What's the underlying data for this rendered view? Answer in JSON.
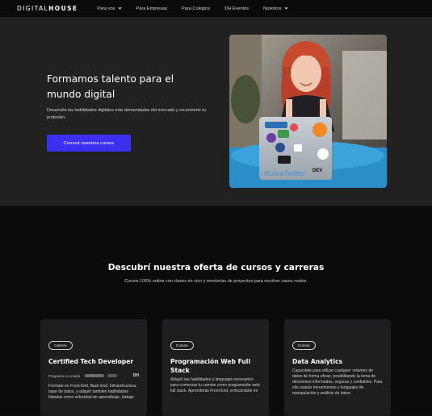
{
  "nav": {
    "logo_light": "DIGITAL",
    "logo_bold": "HOUSE",
    "items": [
      {
        "label": "Para vos",
        "dropdown": true
      },
      {
        "label": "Para Empresas",
        "dropdown": false
      },
      {
        "label": "Para Colegios",
        "dropdown": false
      },
      {
        "label": "DH Eventos",
        "dropdown": false
      },
      {
        "label": "Nosotros",
        "dropdown": true
      }
    ]
  },
  "hero": {
    "title": "Formamos talento para el mundo digital",
    "subtitle": "Desarrolla las habilidades digitales más demandadas del mercado y reconvierte tu profesión.",
    "cta_label": "Conocé nuestros cursos",
    "laptop_sticker": "#LoveTwitter",
    "laptop_sticker2": "DEV"
  },
  "offer": {
    "title": "Descubrí nuestra oferta de cursos y carreras",
    "subtitle": "Cursos 100% online con clases en vivo y mentorías de proyectos para resolver casos reales.",
    "cards": [
      {
        "badge": "Carrera",
        "title": "Certified Tech Developer",
        "partners_label": "Programa co-creado",
        "partner_logo": "DH",
        "text": "Formate en Front End, Back End, Infraestructura, base de datos, y adquirí también habilidades blandas como velocidad de aprendizaje, trabajo"
      },
      {
        "badge": "Cursos",
        "title": "Programación Web Full Stack",
        "text": "Adquirí las habilidades y lenguajes necesarios para comenzar tu camino como programador web full stack. Aprenderás Front End, enfocándote en"
      },
      {
        "badge": "Cursos",
        "title": "Data Analytics",
        "text": "Capacitate para utilizar cualquier volumen de datos de forma eficaz, posibilitando la toma de decisiones informadas, seguras y confiables. Para ello usarás herramientas y lenguajes de manipulación y análisis de datos"
      }
    ]
  },
  "colors": {
    "accent": "#3c2ff0",
    "hero_bg": "#212121",
    "page_bg": "#0b0b0b",
    "card_bg": "#1e1e21"
  }
}
